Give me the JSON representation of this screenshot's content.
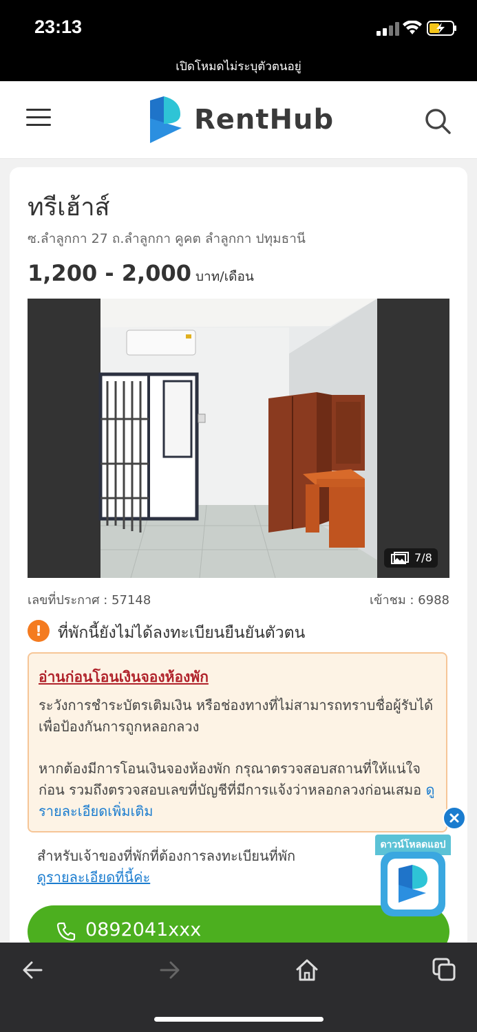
{
  "status_bar": {
    "time": "23:13"
  },
  "private_banner": "เปิดโหมดไม่ระบุตัวตนอยู่",
  "header": {
    "logo_text": "RentHub"
  },
  "listing": {
    "title": "ทรีเฮ้าส์",
    "address": "ซ.ลำลูกกา 27 ถ.ลำลูกกา คูคต ลำลูกกา ปทุมธานี",
    "price": "1,200 - 2,000",
    "price_unit": "บาท/เดือน",
    "photo_counter": "7/8",
    "announcement_no": "เลขที่ประกาศ : 57148",
    "views": "เข้าชม : 6988",
    "unverified_text": "ที่พักนี้ยังไม่ได้ลงทะเบียนยืนยันตัวตน"
  },
  "notice": {
    "title": "อ่านก่อนโอนเงินจองห้องพัก",
    "paragraph1": "ระวังการชำระบัตรเติมเงิน หรือช่องทางที่ไม่สามารถทราบชื่อผู้รับได้ เพื่อป้องกันการถูกหลอกลวง",
    "paragraph2": "หากต้องมีการโอนเงินจองห้องพัก กรุณาตรวจสอบสถานที่ให้แน่ใจก่อน รวมถึงตรวจสอบเลขที่บัญชีที่มีการแจ้งว่าหลอกลวงก่อนเสมอ",
    "more_link": "ดูรายละเอียดเพิ่มเติม"
  },
  "owner": {
    "text": "สำหรับเจ้าของที่พักที่ต้องการลงทะเบียนที่พัก",
    "link": "ดูรายละเอียดที่นี้ค่ะ"
  },
  "call_button": {
    "number": "0892041xxx"
  },
  "app_ad": {
    "label": "ดาวน์โหลดแอป"
  },
  "colors": {
    "accent_green": "#4caf1f",
    "link_blue": "#1a7ccf",
    "warning_orange": "#f47b20",
    "notice_red": "#b0222a"
  }
}
